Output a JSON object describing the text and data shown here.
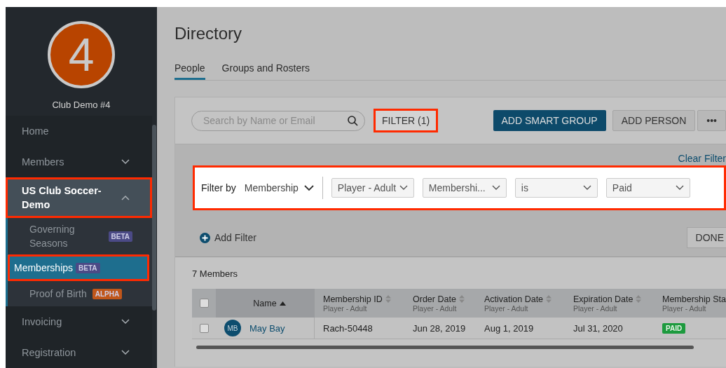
{
  "sidebar": {
    "logo_text": "4",
    "club_name": "Club Demo #4",
    "items": [
      {
        "label": "Home",
        "expandable": false,
        "expanded": false,
        "highlighted": false
      },
      {
        "label": "Members",
        "expandable": true,
        "expanded": false,
        "highlighted": false
      },
      {
        "label": "US Club Soccer-Demo",
        "expandable": true,
        "expanded": true,
        "highlighted": true,
        "children": [
          {
            "label": "Governing Seasons",
            "badge": {
              "text": "BETA",
              "color": "#4b4a86"
            },
            "selected": false,
            "highlighted": false
          },
          {
            "label": "Memberships",
            "badge": {
              "text": "BETA",
              "color": "#4b4a86"
            },
            "selected": true,
            "highlighted": true
          },
          {
            "label": "Proof of Birth",
            "badge": {
              "text": "ALPHA",
              "color": "#c0561a"
            },
            "selected": false,
            "highlighted": false
          }
        ]
      },
      {
        "label": "Invoicing",
        "expandable": true,
        "expanded": false,
        "highlighted": false
      },
      {
        "label": "Registration",
        "expandable": true,
        "expanded": false,
        "highlighted": false
      }
    ]
  },
  "page": {
    "title": "Directory",
    "tabs": [
      {
        "label": "People",
        "selected": true
      },
      {
        "label": "Groups and Rosters",
        "selected": false
      }
    ]
  },
  "toolbar": {
    "search": {
      "placeholder": "Search by Name or Email"
    },
    "filter_button": {
      "label": "FILTER (1)",
      "highlighted": true
    },
    "buttons": [
      {
        "label": "ADD SMART GROUP",
        "kind": "primary"
      },
      {
        "label": "ADD PERSON",
        "kind": "secondary"
      },
      {
        "label": "•••",
        "kind": "secondary"
      }
    ]
  },
  "filter": {
    "clear_link": "Clear Filter",
    "label": "Filter by",
    "field": "Membership",
    "highlighted": true,
    "selects": [
      "Player - Adult",
      "Membershi...",
      "is",
      "Paid"
    ],
    "add_filter": "Add Filter",
    "done": "DONE"
  },
  "table": {
    "count": "7 Members",
    "all_checked": false,
    "columns": [
      {
        "title": "Name",
        "kind": "person",
        "sorted": true
      },
      {
        "title": "Membership ID",
        "subtitle": "Player - Adult",
        "kind": "text",
        "sorted": false
      },
      {
        "title": "Order Date",
        "subtitle": "Player - Adult",
        "kind": "text",
        "sorted": false
      },
      {
        "title": "Activation Date",
        "subtitle": "Player - Adult",
        "kind": "text",
        "sorted": false
      },
      {
        "title": "Expiration Date",
        "subtitle": "Player - Adult",
        "kind": "text",
        "sorted": false
      },
      {
        "title": "Membership Sta",
        "subtitle": "Player - Adult",
        "kind": "tag"
      }
    ],
    "rows": [
      {
        "checked": false,
        "initials": "MB",
        "cells": [
          "May Bay",
          "Rach-50448",
          "Jun 28, 2019",
          "Aug 1, 2019",
          "Jul 31, 2020",
          "PAID"
        ]
      }
    ]
  }
}
